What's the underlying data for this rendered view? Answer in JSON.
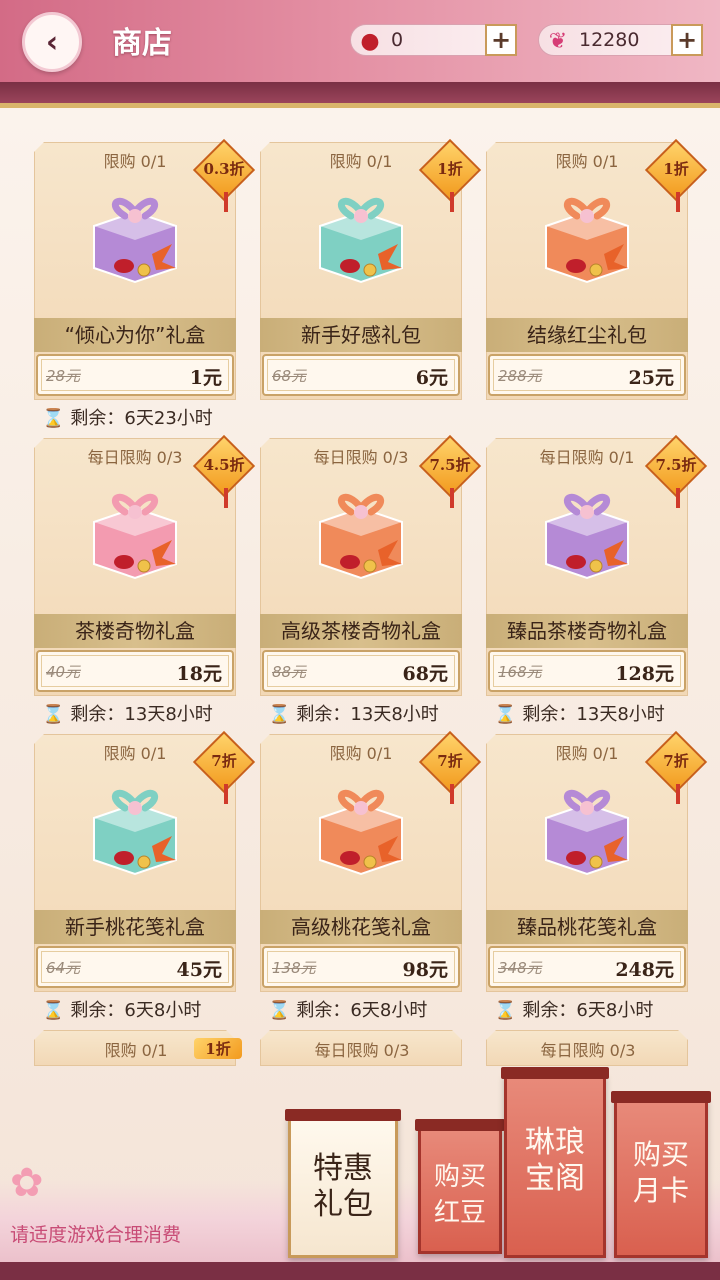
{
  "header": {
    "title": "商店",
    "back_icon": "‹",
    "currencies": [
      {
        "icon": "red-bean-icon",
        "glyph": "●",
        "amount": "0",
        "plus": "+"
      },
      {
        "icon": "butterfly-icon",
        "glyph": "❦",
        "amount": "12280",
        "plus": "+"
      }
    ]
  },
  "cards": [
    {
      "limit": "限购 0/1",
      "discount": "0.3折",
      "name": "“倾心为你”礼盒",
      "orig_price": "28元",
      "price": "1元",
      "timer": "剩余：6天23小时",
      "gift_color": "#b58ad6"
    },
    {
      "limit": "限购 0/1",
      "discount": "1折",
      "name": "新手好感礼包",
      "orig_price": "68元",
      "price": "6元",
      "timer": "",
      "gift_color": "#7fd0c3"
    },
    {
      "limit": "限购 0/1",
      "discount": "1折",
      "name": "结缘红尘礼包",
      "orig_price": "288元",
      "price": "25元",
      "timer": "",
      "gift_color": "#f08a5a"
    },
    {
      "limit": "每日限购 0/3",
      "discount": "4.5折",
      "name": "茶楼奇物礼盒",
      "orig_price": "40元",
      "price": "18元",
      "timer": "剩余：13天8小时",
      "gift_color": "#f39bb0"
    },
    {
      "limit": "每日限购 0/3",
      "discount": "7.5折",
      "name": "高级茶楼奇物礼盒",
      "orig_price": "88元",
      "price": "68元",
      "timer": "剩余：13天8小时",
      "gift_color": "#f08a5a"
    },
    {
      "limit": "每日限购 0/1",
      "discount": "7.5折",
      "name": "臻品茶楼奇物礼盒",
      "orig_price": "168元",
      "price": "128元",
      "timer": "剩余：13天8小时",
      "gift_color": "#b58ad6"
    },
    {
      "limit": "限购 0/1",
      "discount": "7折",
      "name": "新手桃花笺礼盒",
      "orig_price": "64元",
      "price": "45元",
      "timer": "剩余：6天8小时",
      "gift_color": "#7fd0c3"
    },
    {
      "limit": "限购 0/1",
      "discount": "7折",
      "name": "高级桃花笺礼盒",
      "orig_price": "138元",
      "price": "98元",
      "timer": "剩余：6天8小时",
      "gift_color": "#f08a5a"
    },
    {
      "limit": "限购 0/1",
      "discount": "7折",
      "name": "臻品桃花笺礼盒",
      "orig_price": "348元",
      "price": "248元",
      "timer": "剩余：6天8小时",
      "gift_color": "#b58ad6"
    }
  ],
  "partial_cards": [
    {
      "limit": "限购 0/1",
      "discount": "1折"
    },
    {
      "limit": "每日限购 0/3",
      "discount": ""
    },
    {
      "limit": "每日限购 0/3",
      "discount": ""
    }
  ],
  "bottom": {
    "notice": "请适度游戏合理消费",
    "tabs": [
      {
        "line1": "特惠",
        "line2": "礼包"
      },
      {
        "line1": "购买",
        "line2": "红豆"
      },
      {
        "line1": "琳琅",
        "line2": "宝阁"
      },
      {
        "line1": "购买",
        "line2": "月卡"
      }
    ]
  }
}
